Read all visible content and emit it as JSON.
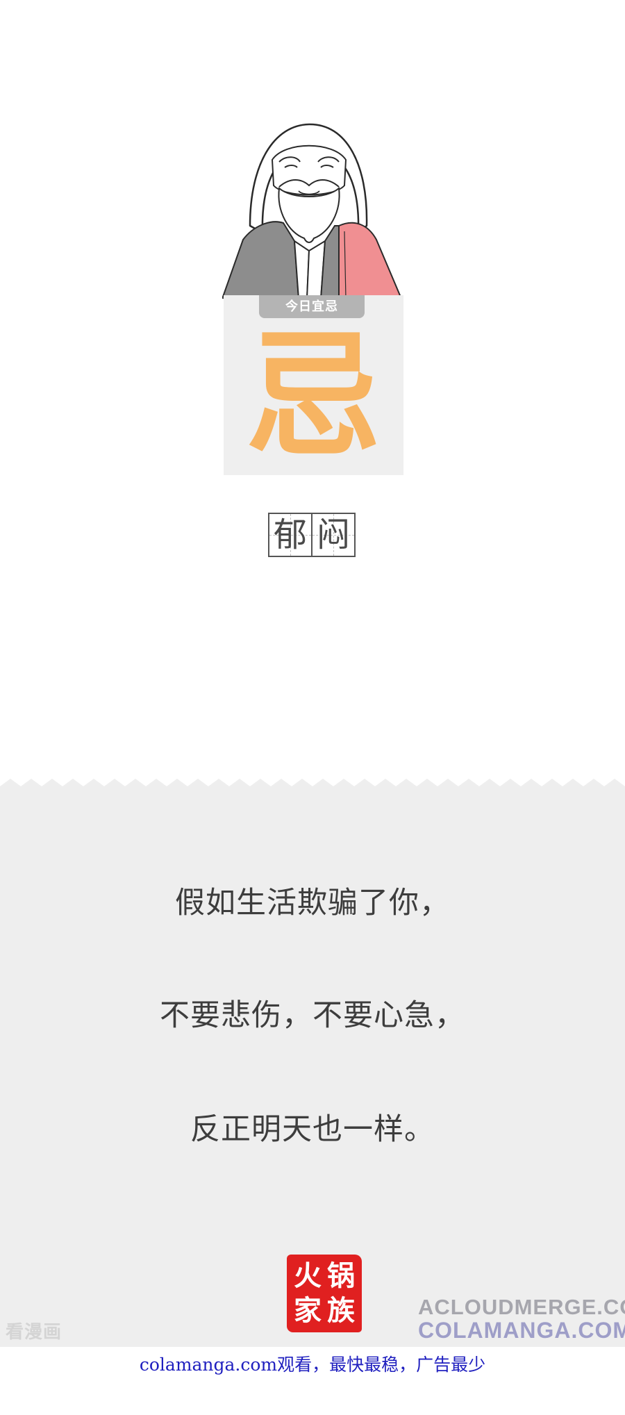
{
  "daily_card": {
    "tab_label": "今日宜忌",
    "glyph": "忌"
  },
  "word_grid": {
    "characters": [
      "郁",
      "闷"
    ]
  },
  "quote": {
    "lines": [
      "假如生活欺骗了你，",
      "不要悲伤，不要心急，",
      "反正明天也一样。"
    ]
  },
  "seal": {
    "characters": [
      "火",
      "锅",
      "家",
      "族"
    ],
    "color": "#e02020"
  },
  "watermarks": {
    "left": "看漫画",
    "right_top": "ACLOUDMERGE.COM",
    "right_bottom": "COLAMANGA.COM"
  },
  "footer": {
    "link_text": "colamanga.com观看，最快最稳，广告最少"
  },
  "colors": {
    "accent_orange": "#f7b462",
    "panel_grey": "#eeeeee",
    "robe_pink": "#f08f92",
    "link_blue": "#1f1fbf"
  },
  "icons": {
    "illustration": "bearded-sage-icon"
  }
}
